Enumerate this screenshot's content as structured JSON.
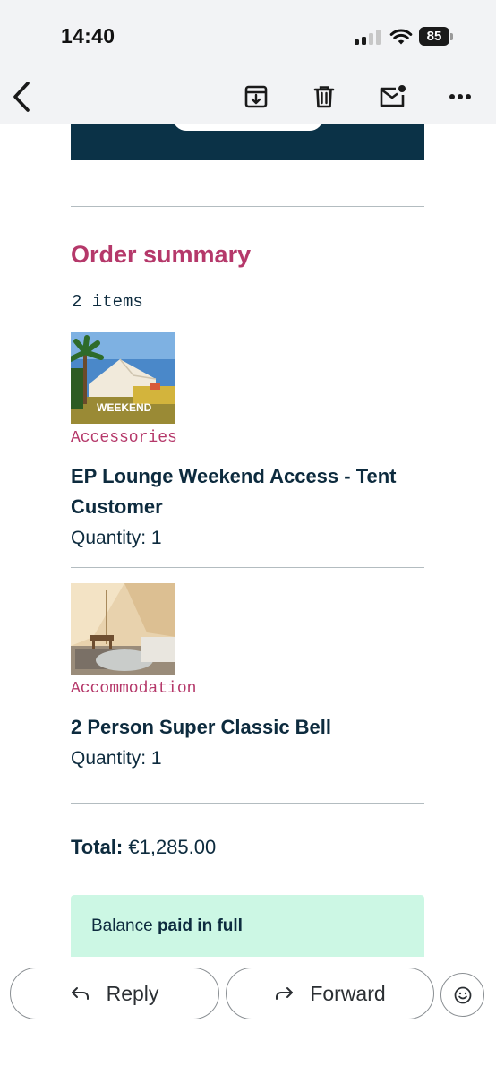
{
  "status_bar": {
    "time": "14:40",
    "battery": "85",
    "signal_bars_active": 2,
    "signal_bars_total": 4
  },
  "toolbar": {
    "icons": [
      "back-chevron-icon",
      "archive-icon",
      "trash-icon",
      "mark-unread-icon",
      "more-icon"
    ]
  },
  "email": {
    "section_title": "Order summary",
    "item_count": "2 items",
    "items": [
      {
        "category": "Accessories",
        "title": "EP Lounge Weekend Access - Tent Customer",
        "quantity": "Quantity: 1",
        "image_caption": "WEEKEND"
      },
      {
        "category": "Accommodation",
        "title": "2 Person Super Classic Bell",
        "quantity": "Quantity: 1"
      }
    ],
    "total_label": "Total:",
    "total_value": " €1,285.00",
    "balance_prefix": "Balance ",
    "balance_bold": "paid in full"
  },
  "actions": {
    "reply_label": "Reply",
    "forward_label": "Forward",
    "emoji_icon": "smiley-icon"
  },
  "colors": {
    "accent_heading": "#b5386a",
    "text_dark": "#0d2b3e",
    "banner": "#0b3247",
    "balance_bg": "#ccf7e4",
    "chrome_bg": "#f2f3f5"
  }
}
